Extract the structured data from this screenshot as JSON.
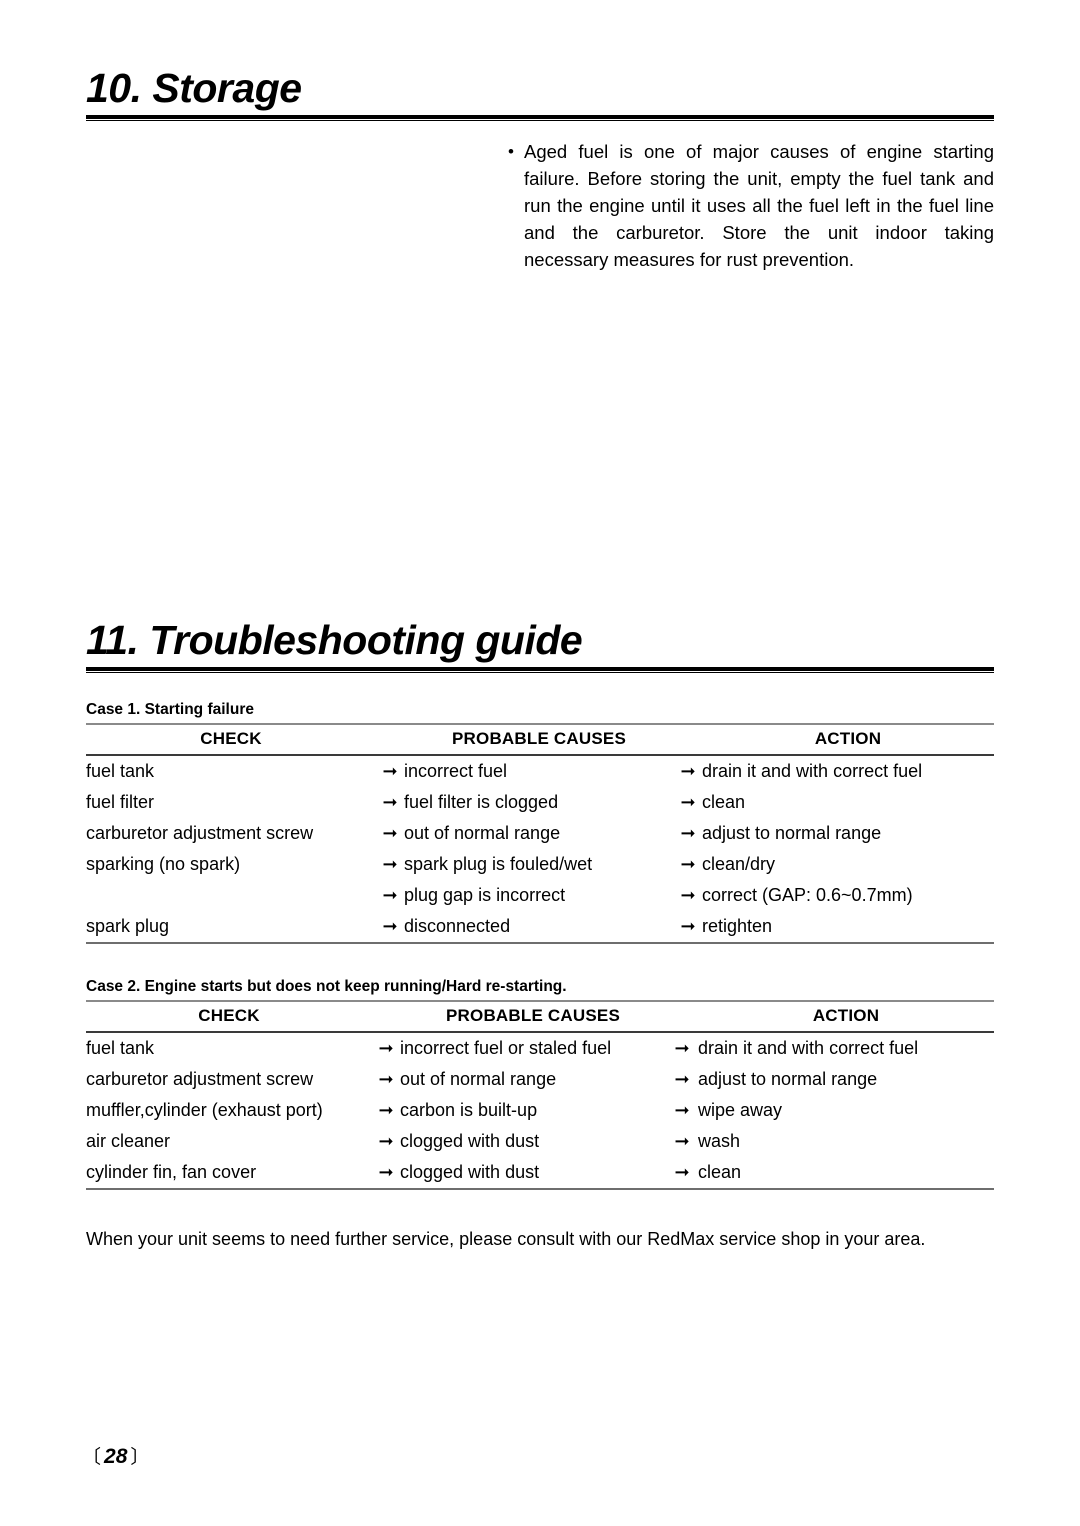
{
  "document": {
    "page_number": "28",
    "page_number_open_bracket": "〔",
    "page_number_close_bracket": "〕"
  },
  "sections": {
    "storage": {
      "heading": "10. Storage",
      "bullet_marker": "•",
      "paragraph": "Aged fuel is one of major causes of engine starting failure. Before storing the unit, empty the fuel tank and run the engine until it uses all the fuel left in the fuel line and the carburetor. Store the unit indoor taking necessary measures for rust prevention."
    },
    "troubleshooting": {
      "heading": "11. Troubleshooting guide",
      "arrow_glyph": "➞",
      "columns": {
        "check": "CHECK",
        "probable_causes": "PROBABLE CAUSES",
        "action": "ACTION"
      },
      "case1": {
        "title": "Case 1. Starting failure",
        "rows": [
          {
            "check": "fuel tank",
            "cause": "incorrect fuel",
            "action": "drain it and with correct fuel"
          },
          {
            "check": "fuel filter",
            "cause": "fuel filter is clogged",
            "action": "clean"
          },
          {
            "check": "carburetor adjustment screw",
            "cause": "out of normal range",
            "action": "adjust to normal range"
          },
          {
            "check": "sparking (no spark)",
            "cause": "spark plug is fouled/wet",
            "action": "clean/dry"
          },
          {
            "check": "",
            "cause": "plug gap is incorrect",
            "action": "correct (GAP: 0.6~0.7mm)"
          },
          {
            "check": "spark plug",
            "cause": "disconnected",
            "action": "retighten"
          }
        ]
      },
      "case2": {
        "title": "Case 2. Engine starts but does not keep running/Hard re-starting.",
        "rows": [
          {
            "check": "fuel tank",
            "cause": "incorrect fuel or staled fuel",
            "action": "drain it and with correct fuel"
          },
          {
            "check": "carburetor adjustment screw",
            "cause": "out of normal range",
            "action": "adjust to normal range"
          },
          {
            "check": "muffler,cylinder (exhaust port)",
            "cause": "carbon is built-up",
            "action": "wipe away"
          },
          {
            "check": "air cleaner",
            "cause": "clogged with dust",
            "action": "wash"
          },
          {
            "check": "cylinder fin, fan cover",
            "cause": "clogged with dust",
            "action": "clean"
          }
        ]
      },
      "footer_note": "When your unit seems to need further service, please consult with our RedMax service shop in your area."
    }
  }
}
